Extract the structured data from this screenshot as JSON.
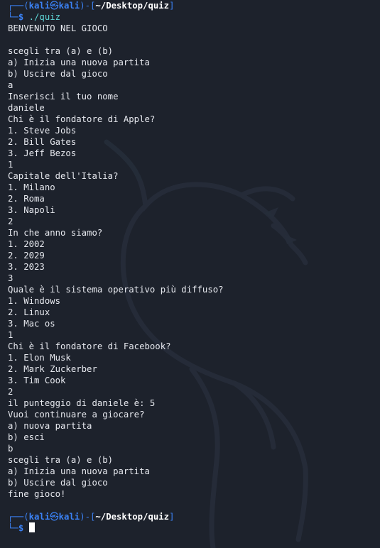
{
  "prompt": {
    "user": "kali",
    "host": "kali",
    "path": "~/Desktop/quiz",
    "dollar": "$",
    "command": "./quiz"
  },
  "output": [
    "BENVENUTO NEL GIOCO",
    "",
    "scegli tra (a) e (b)",
    "a) Inizia una nuova partita",
    "b) Uscire dal gioco",
    "a",
    "Inserisci il tuo nome",
    "daniele",
    "Chi è il fondatore di Apple?",
    "1. Steve Jobs",
    "2. Bill Gates",
    "3. Jeff Bezos",
    "1",
    "Capitale dell'Italia?",
    "1. Milano",
    "2. Roma",
    "3. Napoli",
    "2",
    "In che anno siamo?",
    "1. 2002",
    "2. 2029",
    "3. 2023",
    "3",
    "Quale è il sistema operativo più diffuso?",
    "1. Windows",
    "2. Linux",
    "3. Mac os",
    "1",
    "Chi è il fondatore di Facebook?",
    "1. Elon Musk",
    "2. Mark Zuckerber",
    "3. Tim Cook",
    "2",
    "il punteggio di daniele è: 5",
    "Vuoi continuare a giocare?",
    "a) nuova partita",
    "b) esci",
    "b",
    "scegli tra (a) e (b)",
    "a) Inizia una nuova partita",
    "b) Uscire dal gioco",
    "fine gioco!"
  ],
  "prompt2": {
    "user": "kali",
    "host": "kali",
    "path": "~/Desktop/quiz",
    "dollar": "$"
  }
}
